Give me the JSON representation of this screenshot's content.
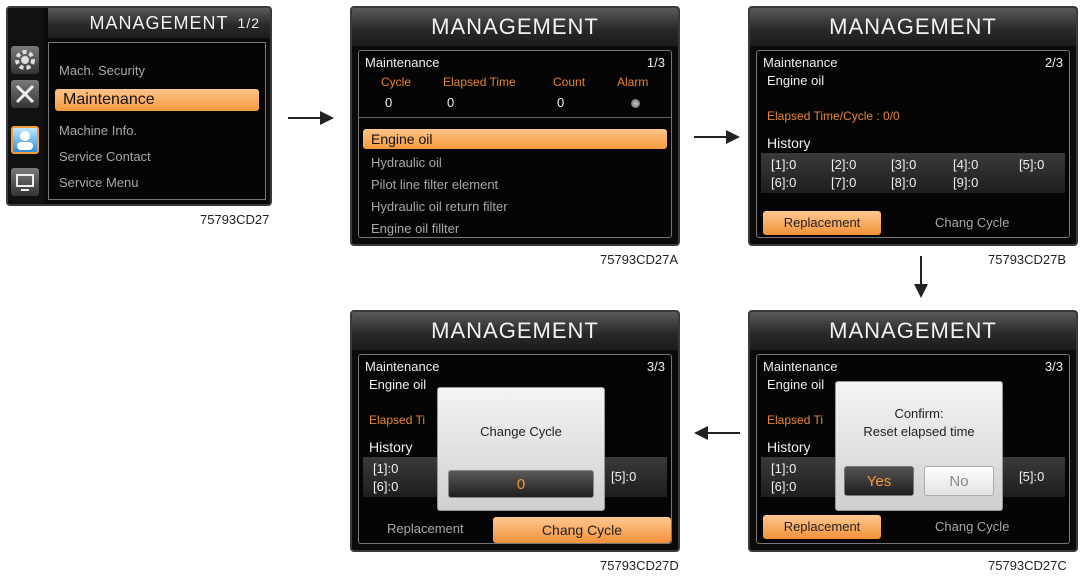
{
  "screens": {
    "s1": {
      "title": "MANAGEMENT",
      "page": "1/2",
      "menu": [
        "Mach. Security",
        "Maintenance",
        "Machine Info.",
        "Service Contact",
        "Service Menu"
      ],
      "caption": "75793CD27"
    },
    "s2": {
      "title": "MANAGEMENT",
      "section": "Maintenance",
      "page": "1/3",
      "headers": [
        "Cycle",
        "Elapsed Time",
        "Count",
        "Alarm"
      ],
      "values": [
        "0",
        "0",
        "0"
      ],
      "items": [
        "Engine oil",
        "Hydraulic oil",
        "Pilot line filter element",
        "Hydraulic oil return filter",
        "Engine oil fillter"
      ],
      "caption": "75793CD27A"
    },
    "s3": {
      "title": "MANAGEMENT",
      "section": "Maintenance",
      "page": "2/3",
      "item": "Engine oil",
      "elapsed": "Elapsed Time/Cycle : 0/0",
      "history_label": "History",
      "history_row1": [
        "[1]:0",
        "[2]:0",
        "[3]:0",
        "[4]:0",
        "[5]:0"
      ],
      "history_row2": [
        "[6]:0",
        "[7]:0",
        "[8]:0",
        "[9]:0"
      ],
      "btn_replacement": "Replacement",
      "btn_change": "Chang Cycle",
      "caption": "75793CD27B"
    },
    "s4": {
      "title": "MANAGEMENT",
      "section": "Maintenance",
      "page": "3/3",
      "item": "Engine oil",
      "elapsed": "Elapsed Ti",
      "history_label": "History",
      "h1": "[1]:0",
      "h6": "[6]:0",
      "h5": "[5]:0",
      "dialog_title": "Change Cycle",
      "dialog_value": "0",
      "btn_replacement": "Replacement",
      "btn_change": "Chang Cycle",
      "caption": "75793CD27D"
    },
    "s5": {
      "title": "MANAGEMENT",
      "section": "Maintenance",
      "page": "3/3",
      "item": "Engine oil",
      "elapsed": "Elapsed Ti",
      "history_label": "History",
      "h1": "[1]:0",
      "h6": "[6]:0",
      "h5": "[5]:0",
      "confirm_line1": "Confirm:",
      "confirm_line2": "Reset elapsed time",
      "yes": "Yes",
      "no": "No",
      "btn_replacement": "Replacement",
      "btn_change": "Chang Cycle",
      "caption": "75793CD27C"
    }
  }
}
